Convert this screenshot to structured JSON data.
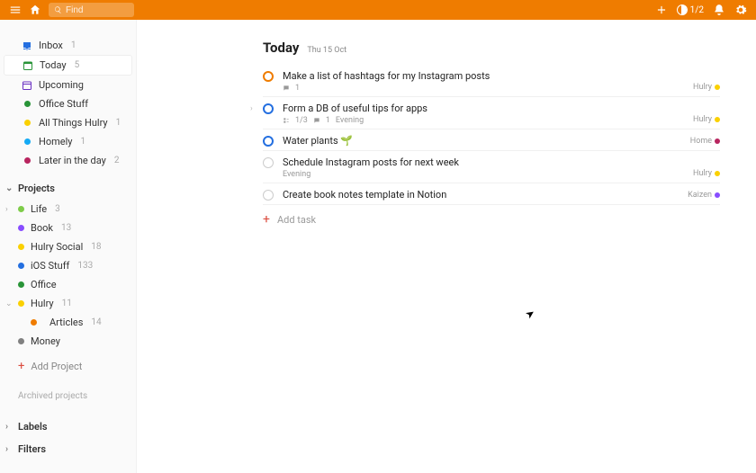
{
  "header": {
    "search_placeholder": "Find",
    "progress_text": "1/2"
  },
  "sidebar": {
    "top": [
      {
        "key": "inbox",
        "label": "Inbox",
        "count": "1",
        "selected": false
      },
      {
        "key": "today",
        "label": "Today",
        "count": "5",
        "selected": true
      },
      {
        "key": "upcoming",
        "label": "Upcoming",
        "count": "",
        "selected": false
      },
      {
        "key": "office",
        "label": "Office Stuff",
        "count": "",
        "selected": false,
        "dot": "#299438"
      },
      {
        "key": "hulry",
        "label": "All Things Hulry",
        "count": "1",
        "selected": false,
        "dot": "#fad000"
      },
      {
        "key": "homely",
        "label": "Homely",
        "count": "1",
        "selected": false,
        "dot": "#14aaf5"
      },
      {
        "key": "later",
        "label": "Later in the day",
        "count": "2",
        "selected": false,
        "dot": "#b8255f"
      }
    ],
    "projects_label": "Projects",
    "projects": [
      {
        "label": "Life",
        "count": "3",
        "dot": "#7ecc49",
        "toggle": "right"
      },
      {
        "label": "Book",
        "count": "13",
        "dot": "#884dff"
      },
      {
        "label": "Hulry Social",
        "count": "18",
        "dot": "#fad000"
      },
      {
        "label": "iOS Stuff",
        "count": "133",
        "dot": "#246fe0"
      },
      {
        "label": "Office",
        "count": "",
        "dot": "#299438"
      },
      {
        "label": "Hulry",
        "count": "11",
        "dot": "#fad000",
        "toggle": "down",
        "children": [
          {
            "label": "Articles",
            "count": "14",
            "dot": "#ef7c00"
          }
        ]
      },
      {
        "label": "Money",
        "count": "",
        "dot": "#808080"
      }
    ],
    "add_project_label": "Add Project",
    "archived_label": "Archived projects",
    "labels_label": "Labels",
    "filters_label": "Filters"
  },
  "main": {
    "title": "Today",
    "date": "Thu 15 Oct",
    "add_task_label": "Add task",
    "tasks": [
      {
        "title": "Make a list of hashtags for my Instagram posts",
        "priority": "p1",
        "meta_comment": "1",
        "project": "Hulry",
        "project_dot": "#fad000"
      },
      {
        "title": "Form a DB of useful tips for apps",
        "priority": "p2",
        "meta_subtasks": "1/3",
        "meta_comment": "1",
        "meta_time": "Evening",
        "project": "Hulry",
        "project_dot": "#fad000",
        "expandable": true
      },
      {
        "title": "Water plants 🌱",
        "priority": "p2",
        "project": "Home",
        "project_dot": "#b8255f"
      },
      {
        "title": "Schedule Instagram posts for next week",
        "priority": "",
        "meta_time": "Evening",
        "project": "Hulry",
        "project_dot": "#fad000"
      },
      {
        "title": "Create book notes template in Notion",
        "priority": "",
        "project": "Kaizen",
        "project_dot": "#884dff"
      }
    ]
  }
}
